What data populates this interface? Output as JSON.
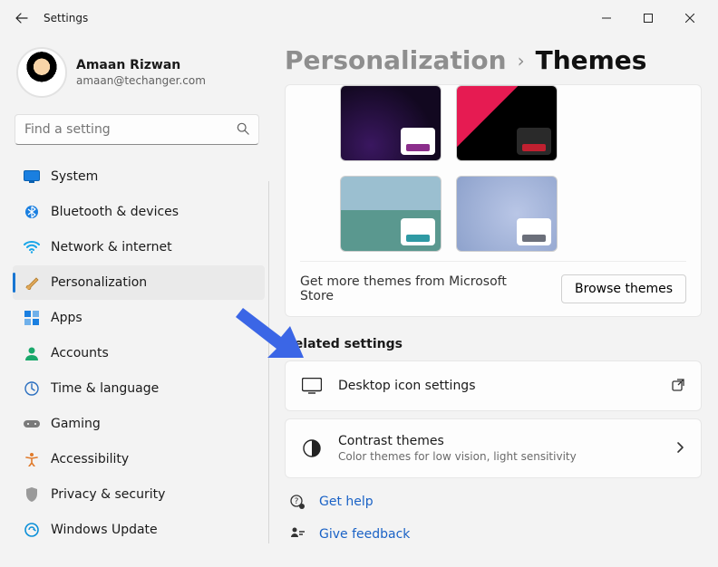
{
  "app": {
    "title": "Settings"
  },
  "profile": {
    "name": "Amaan Rizwan",
    "email": "amaan@techanger.com"
  },
  "search": {
    "placeholder": "Find a setting"
  },
  "nav": {
    "items": [
      {
        "label": "System"
      },
      {
        "label": "Bluetooth & devices"
      },
      {
        "label": "Network & internet"
      },
      {
        "label": "Personalization"
      },
      {
        "label": "Apps"
      },
      {
        "label": "Accounts"
      },
      {
        "label": "Time & language"
      },
      {
        "label": "Gaming"
      },
      {
        "label": "Accessibility"
      },
      {
        "label": "Privacy & security"
      },
      {
        "label": "Windows Update"
      }
    ],
    "selected_index": 3
  },
  "breadcrumb": {
    "parent": "Personalization",
    "current": "Themes"
  },
  "themes": {
    "swatches": [
      "#8b2e8b",
      "#c02030",
      "#2f9aa4",
      "#6b6f7a"
    ],
    "store_text": "Get more themes from Microsoft Store",
    "browse_label": "Browse themes"
  },
  "related": {
    "title": "Related settings",
    "cards": [
      {
        "title": "Desktop icon settings",
        "sub": ""
      },
      {
        "title": "Contrast themes",
        "sub": "Color themes for low vision, light sensitivity"
      }
    ]
  },
  "links": {
    "help": "Get help",
    "feedback": "Give feedback"
  },
  "overlay_arrow_color": "#3b66e6"
}
